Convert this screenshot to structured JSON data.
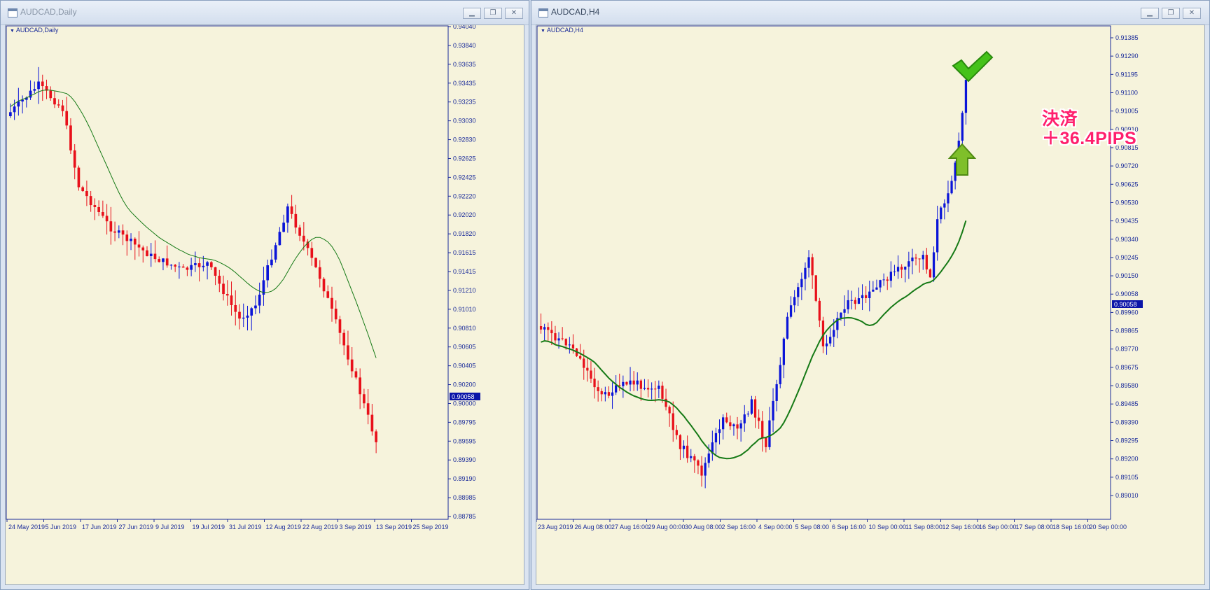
{
  "windows": {
    "left": {
      "title": "AUDCAD,Daily",
      "chart_label": "AUDCAD,Daily",
      "price_label": "0.90058",
      "y_ticks": [
        "0.94040",
        "0.93840",
        "0.93635",
        "0.93435",
        "0.93235",
        "0.93030",
        "0.92830",
        "0.92625",
        "0.92425",
        "0.92220",
        "0.92020",
        "0.91820",
        "0.91615",
        "0.91415",
        "0.91210",
        "0.91010",
        "0.90810",
        "0.90605",
        "0.90405",
        "0.90200",
        "0.90000",
        "0.89795",
        "0.89595",
        "0.89390",
        "0.89190",
        "0.88985",
        "0.88785"
      ],
      "x_ticks": [
        "24 May 2019",
        "5 Jun 2019",
        "17 Jun 2019",
        "27 Jun 2019",
        "9 Jul 2019",
        "19 Jul 2019",
        "31 Jul 2019",
        "12 Aug 2019",
        "22 Aug 2019",
        "3 Sep 2019",
        "13 Sep 2019",
        "25 Sep 2019"
      ]
    },
    "right": {
      "title": "AUDCAD,H4",
      "chart_label": "AUDCAD,H4",
      "price_label": "0.90058",
      "y_ticks": [
        "0.91385",
        "0.91290",
        "0.91195",
        "0.91100",
        "0.91005",
        "0.90910",
        "0.90815",
        "0.90720",
        "0.90625",
        "0.90530",
        "0.90435",
        "0.90340",
        "0.90245",
        "0.90150",
        "0.90058",
        "0.89960",
        "0.89865",
        "0.89770",
        "0.89675",
        "0.89580",
        "0.89485",
        "0.89390",
        "0.89295",
        "0.89200",
        "0.89105",
        "0.89010"
      ],
      "x_ticks": [
        "23 Aug 2019",
        "26 Aug 08:00",
        "27 Aug 16:00",
        "29 Aug 00:00",
        "30 Aug 08:00",
        "2 Sep 16:00",
        "4 Sep 00:00",
        "5 Sep 08:00",
        "6 Sep 16:00",
        "10 Sep 00:00",
        "11 Sep 08:00",
        "12 Sep 16:00",
        "16 Sep 00:00",
        "17 Sep 08:00",
        "18 Sep 16:00",
        "20 Sep 00:00"
      ],
      "annotation": {
        "line1": "決済",
        "line2": "＋36.4PIPS"
      }
    }
  },
  "colors": {
    "bull": "#0a14d8",
    "bear": "#e8101a",
    "ma": "#167a16",
    "axis_text": "#1a2b9a",
    "price_box": "#0a14a8",
    "chart_bg": "#f6f3dc"
  },
  "icons": [
    "checkmark-icon",
    "up-arrow-icon",
    "minimize-icon",
    "restore-icon",
    "close-icon"
  ]
}
